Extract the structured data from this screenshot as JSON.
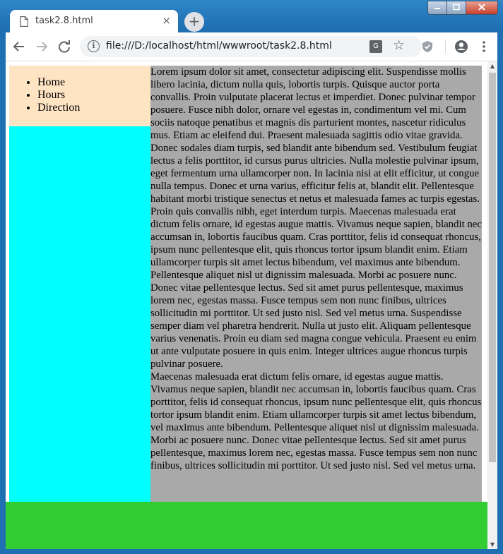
{
  "browser": {
    "tab_title": "task2.8.html",
    "tab_close": "×",
    "new_tab": "+",
    "url": "file:///D:/localhost/html/wwwroot/task2.8.html",
    "icons": {
      "back": "back-arrow-icon",
      "forward": "forward-arrow-icon",
      "reload": "reload-icon",
      "info": "info-icon",
      "translate": "translate-icon",
      "star": "star-icon",
      "shield": "shield-icon",
      "account": "account-icon",
      "menu": "menu-icon"
    }
  },
  "nav": {
    "items": [
      "Home",
      "Hours",
      "Direction"
    ]
  },
  "content": {
    "paragraph1": "Lorem ipsum dolor sit amet, consectetur adipiscing elit. Suspendisse mollis libero lacinia, dictum nulla quis, lobortis turpis. Quisque auctor porta convallis. Proin vulputate placerat lectus et imperdiet. Donec pulvinar tempor posuere. Fusce nibh dolor, ornare vel egestas in, condimentum vel mi. Cum sociis natoque penatibus et magnis dis parturient montes, nascetur ridiculus mus. Etiam ac eleifend dui. Praesent malesuada sagittis odio vitae gravida. Donec sodales diam turpis, sed blandit ante bibendum sed. Vestibulum feugiat lectus a felis porttitor, id cursus purus ultricies. Nulla molestie pulvinar ipsum, eget fermentum urna ullamcorper non. In lacinia nisi at elit efficitur, ut congue nulla tempus. Donec et urna varius, efficitur felis at, blandit elit. Pellentesque habitant morbi tristique senectus et netus et malesuada fames ac turpis egestas. Proin quis convallis nibh, eget interdum turpis. Maecenas malesuada erat dictum felis ornare, id egestas augue mattis. Vivamus neque sapien, blandit nec accumsan in, lobortis faucibus quam. Cras porttitor, felis id consequat rhoncus, ipsum nunc pellentesque elit, quis rhoncus tortor ipsum blandit enim. Etiam ullamcorper turpis sit amet lectus bibendum, vel maximus ante bibendum. Pellentesque aliquet nisl ut dignissim malesuada. Morbi ac posuere nunc. Donec vitae pellentesque lectus. Sed sit amet purus pellentesque, maximus lorem nec, egestas massa. Fusce tempus sem non nunc finibus, ultrices sollicitudin mi porttitor. Ut sed justo nisl. Sed vel metus urna. Suspendisse semper diam vel pharetra hendrerit. Nulla ut justo elit. Aliquam pellentesque varius venenatis. Proin eu diam sed magna congue vehicula. Praesent eu enim ut ante vulputate posuere in quis enim. Integer ultrices augue rhoncus turpis pulvinar posuere.",
    "paragraph2": "Maecenas malesuada erat dictum felis ornare, id egestas augue mattis. Vivamus neque sapien, blandit nec accumsan in, lobortis faucibus quam. Cras porttitor, felis id consequat rhoncus, ipsum nunc pellentesque elit, quis rhoncus tortor ipsum blandit enim. Etiam ullamcorper turpis sit amet lectus bibendum, vel maximus ante bibendum. Pellentesque aliquet nisl ut dignissim malesuada. Morbi ac posuere nunc. Donec vitae pellentesque lectus. Sed sit amet purus pellentesque, maximus lorem nec, egestas massa. Fusce tempus sem non nunc finibus, ultrices sollicitudin mi porttitor. Ut sed justo nisl. Sed vel metus urna."
  },
  "colors": {
    "nav_bg": "#ffe4c4",
    "sidebar_bg": "#00ffff",
    "content_bg": "#a9a9a9",
    "footer_bg": "#32cd32"
  }
}
